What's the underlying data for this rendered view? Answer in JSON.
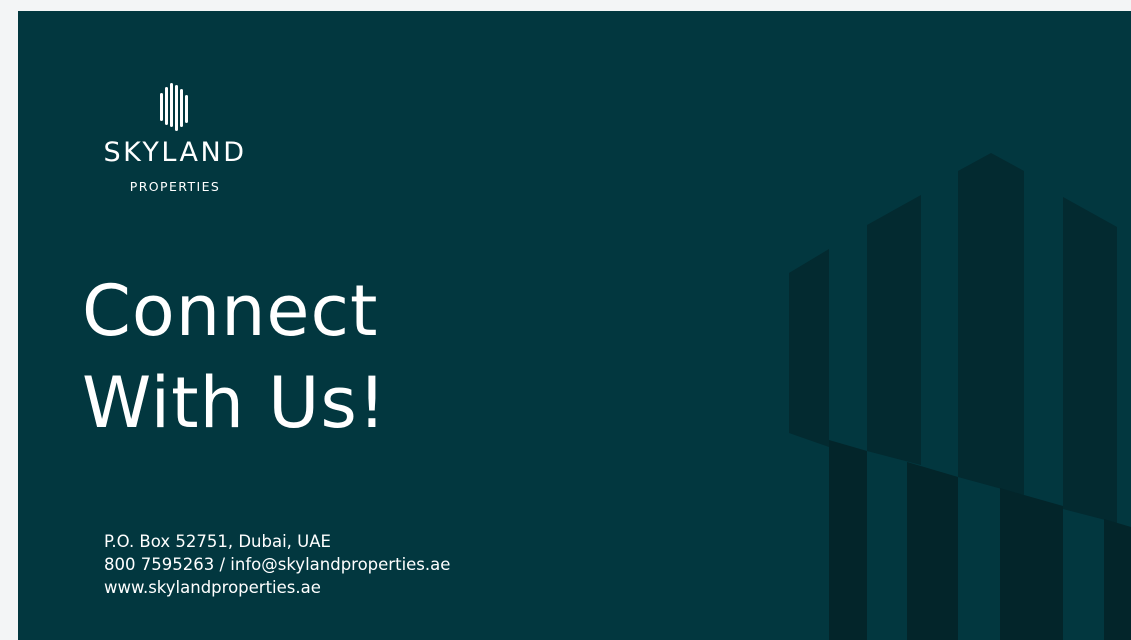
{
  "logo": {
    "name": "SKYLAND",
    "subtitle": "PROPERTIES"
  },
  "headline": {
    "line1": "Connect",
    "line2": "With Us!"
  },
  "contact": {
    "address": "P.O. Box 52751, Dubai, UAE",
    "phone": "800 7595263",
    "separator": "/",
    "email": "info@skylandproperties.ae",
    "website": "www.skylandproperties.ae"
  },
  "colors": {
    "background": "#02373f",
    "building_dark": "#032a30",
    "building_deep": "#03252a",
    "text": "#ffffff"
  }
}
